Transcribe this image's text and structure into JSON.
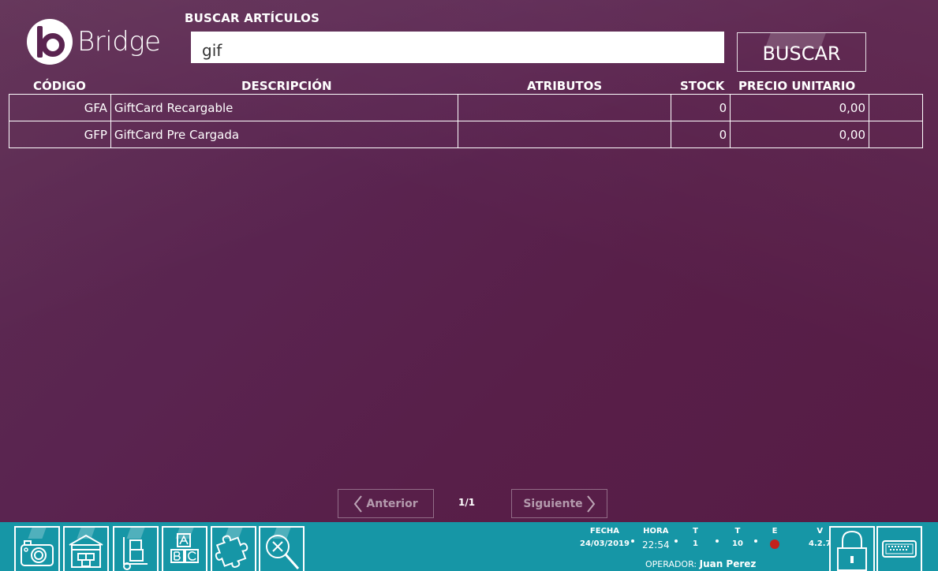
{
  "brand": {
    "name": "Bridge"
  },
  "search": {
    "label": "BUSCAR ARTÍCULOS",
    "value": "gif",
    "button_label": "BUSCAR"
  },
  "table": {
    "headers": [
      "CÓDIGO",
      "DESCRIPCIÓN",
      "ATRIBUTOS",
      "STOCK",
      "PRECIO UNITARIO"
    ],
    "rows": [
      {
        "code": "GFA",
        "description": "GiftCard Recargable",
        "attributes": "",
        "stock": "0",
        "price": "0,00"
      },
      {
        "code": "GFP",
        "description": "GiftCard Pre Cargada",
        "attributes": "",
        "stock": "0",
        "price": "0,00"
      }
    ]
  },
  "pagination": {
    "prev_label": "Anterior",
    "next_label": "Siguiente",
    "page": "1/1"
  },
  "toolbar": {
    "icons": [
      "camera-icon",
      "warehouse-icon",
      "hand-truck-icon",
      "abc-blocks-icon",
      "puzzle-icon",
      "search-cancel-icon"
    ]
  },
  "status": {
    "fecha_label": "FECHA",
    "fecha_value": "24/03/2019",
    "hora_label": "HORA",
    "hora_value": "22:54",
    "t1_label": "T",
    "t1_value": "1",
    "t2_label": "T",
    "t2_value": "10",
    "e_label": "E",
    "v_label": "V",
    "v_value": "4.2.7",
    "operator_label": "OPERADOR:",
    "operator_name": "Juan Perez"
  },
  "colors": {
    "background": "#5a2450",
    "bottom_bar": "#1696a6",
    "status_led": "#c4221c"
  }
}
